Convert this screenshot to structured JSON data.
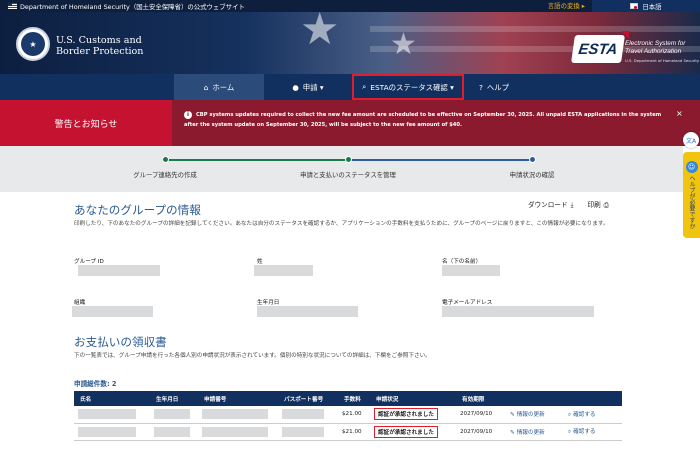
{
  "topbar": {
    "site_text": "Department of Homeland Security（国土安全保障省）の公式ウェブサイト",
    "language_change": "言語の変換 ▸",
    "current_language": "日本語"
  },
  "header": {
    "agency_line1": "U.S. Customs and",
    "agency_line2": "Border Protection",
    "esta_logo": "ESTA",
    "esta_line1": "Electronic System for",
    "esta_line2": "Travel Authorization",
    "esta_sub": "U.S. Department of Homeland Security"
  },
  "nav": {
    "home": "ホーム",
    "apply": "申請 ▾",
    "status": "ESTAのステータス確認 ▾",
    "help": "ヘルプ"
  },
  "alert": {
    "title": "警告とお知らせ",
    "message": "CBP systems updates required to collect the new fee amount are scheduled to be effective on September 30, 2025. All unpaid ESTA applications in the system after the system update on September 30, 2025, will be subject to the new fee amount of $40.",
    "close": "×"
  },
  "side": {
    "translate_icon": "translate-icon",
    "help_tab": "ヘルプが必要ですか"
  },
  "steps": [
    {
      "label": "グループ連絡先の作成"
    },
    {
      "label": "申請と支払いのステータスを管理"
    },
    {
      "label": "申請状況の確認"
    }
  ],
  "group": {
    "title": "あなたのグループの情報",
    "download": "ダウンロード",
    "print": "印刷",
    "description": "印刷したり、下のあなたのグループの詳細を記録してください。あなたは自分のステータスを確認するか、アプリケーションの手数料を支払うために、グループのページに戻りますと、この情報が必要になります。",
    "group_id_label": "グループ ID",
    "surname_label": "姓",
    "given_name_label": "名（下の名前）",
    "organization_label": "組織",
    "dob_label": "生年月日",
    "email_label": "電子メールアドレス"
  },
  "receipt": {
    "title": "お支払いの領収書",
    "description": "下の一覧表では、グループ申請を行った各個人別の申請状況が表示されています。個別の特別な状況についての詳細は、下欄をご参照下さい。",
    "count_label": "申請総件数: 2",
    "columns": [
      "氏名",
      "生年月日",
      "申請番号",
      "パスポート番号",
      "手数料",
      "申請状況",
      "有効期限",
      "",
      ""
    ],
    "rows": [
      {
        "fee": "$21.00",
        "status": "認証が承認されました",
        "expiry": "2027/09/10",
        "update": "情報の更新",
        "check": "確認する"
      },
      {
        "fee": "$21.00",
        "status": "認証が承認されました",
        "expiry": "2027/09/10",
        "update": "情報の更新",
        "check": "確認する"
      }
    ]
  },
  "colors": {
    "navy": "#12305f",
    "alert_red": "#c41230",
    "highlight_red": "#e11d2b",
    "link_blue": "#2a5a93"
  }
}
